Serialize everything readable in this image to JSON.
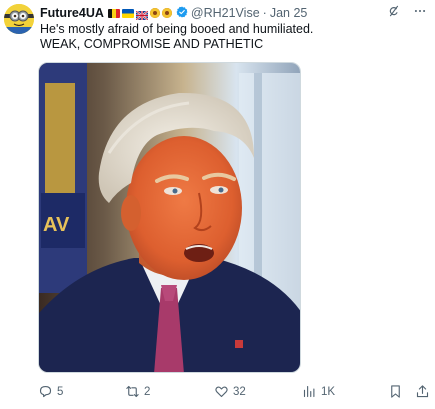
{
  "author": {
    "display_name": "Future4UA",
    "handle": "@RH21Vise",
    "separator": "·",
    "date": "Jan 25"
  },
  "tweet": {
    "line1": "He's mostly afraid of being booed and humiliated.",
    "line2": "WEAK, COMPROMISE AND PATHETIC"
  },
  "media": {
    "badge_text": "AV"
  },
  "actions": {
    "replies": "5",
    "retweets": "2",
    "likes": "32",
    "views": "1K"
  },
  "colors": {
    "text": "#0f1419",
    "muted": "#536471",
    "verified": "#1d9bf0"
  }
}
